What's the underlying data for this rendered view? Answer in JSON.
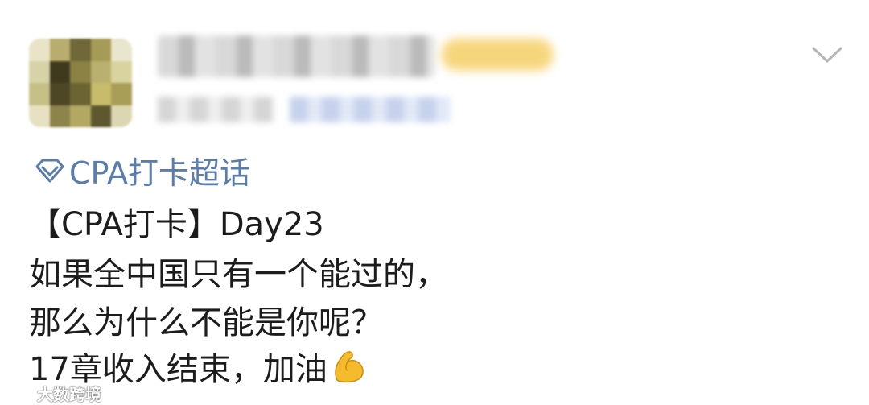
{
  "topic": {
    "label": "CPA打卡超话",
    "icon": "supertopic-diamond-icon",
    "color": "#5b7dac"
  },
  "post": {
    "lines": [
      "【CPA打卡】Day23",
      "如果全中国只有一个能过的，",
      "那么为什么不能是你呢？",
      "17章收入结束，加油"
    ],
    "emoji": "flexed-biceps-emoji"
  },
  "header": {
    "menu_icon": "chevron-down-icon"
  },
  "watermark": {
    "text": "大数跨境",
    "icon": "watermark-logo-icon"
  }
}
